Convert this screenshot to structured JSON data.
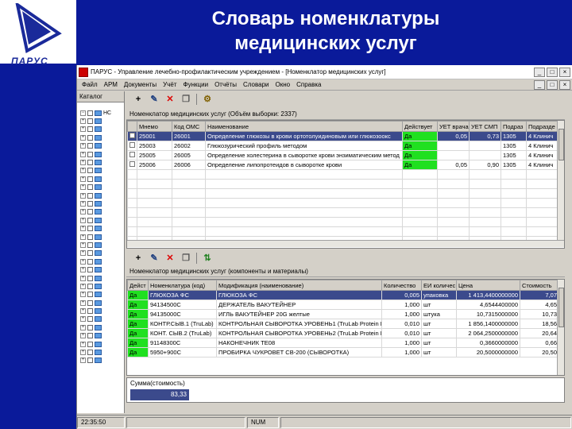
{
  "slide": {
    "title_line1": "Словарь номенклатуры",
    "title_line2": "медицинских услуг",
    "logo_text": "ПАРУС"
  },
  "window": {
    "title": "ПАРУС - Управление лечебно-профилактическим учреждением - [Номенклатор медицинских услуг]",
    "minimize": "_",
    "maximize": "□",
    "close": "×"
  },
  "menu": [
    "Файл",
    "АРМ",
    "Документы",
    "Учёт",
    "Функции",
    "Отчёты",
    "Словари",
    "Окно",
    "Справка"
  ],
  "menu_right": [
    "_",
    "□",
    "×"
  ],
  "left_panel": {
    "tab_label": "Каталог",
    "root_label": "НС",
    "rows": 31
  },
  "grid1": {
    "header_label": "Номенклатор медицинских услуг (Объём выборки: 2337)",
    "columns": [
      "",
      "Мнемо",
      "Код ОМС",
      "Наименование",
      "Действует",
      "УЕТ врача",
      "УЕТ СМП",
      "Подраз",
      "Подразде"
    ],
    "rows": [
      {
        "mnemo": "25001",
        "oms": "26001",
        "name": "Определение глюкозы в крови ортотолуидиновым или глюкозоокс",
        "active": "Да",
        "uet_doc": "0,05",
        "uet_smp": "0,73",
        "podr": "1305",
        "podr2": "4 Клинич",
        "selected": true
      },
      {
        "mnemo": "25003",
        "oms": "26002",
        "name": "Глюкозурический профиль методом",
        "active": "Да",
        "uet_doc": "",
        "uet_smp": "",
        "podr": "1305",
        "podr2": "4 Клинич",
        "selected": false
      },
      {
        "mnemo": "25005",
        "oms": "26005",
        "name": "Определение холестерина в сыворотке крови энзиматическим метод",
        "active": "Да",
        "uet_doc": "",
        "uet_smp": "",
        "podr": "1305",
        "podr2": "4 Клинич",
        "selected": false
      },
      {
        "mnemo": "25006",
        "oms": "26006",
        "name": "Определение липопротеидов в сыворотке крови",
        "active": "Да",
        "uet_doc": "0,05",
        "uet_smp": "0,90",
        "podr": "1305",
        "podr2": "4 Клинич",
        "selected": false
      }
    ]
  },
  "grid2": {
    "header_label": "Номенклатор медицинских услуг (компоненты и материалы)",
    "columns": [
      "Дейст",
      "Номенклатура (код)",
      "Модификация (наименование)",
      "Количество",
      "ЕИ количес",
      "Цена",
      "Стоимость"
    ],
    "rows": [
      {
        "active": "Да",
        "nom": "ГЛЮКОЗА ФС",
        "mod": "ГЛЮКОЗА ФС",
        "qty": "0,005",
        "unit": "упаковка",
        "price": "1 413,4400000000",
        "cost": "7,07",
        "selected": true
      },
      {
        "active": "Да",
        "nom": "94134500С",
        "mod": "ДЕРЖАТЕЛЬ ВАКУТЕЙНЕР",
        "qty": "1,000",
        "unit": "шт",
        "price": "4,6544400000",
        "cost": "4,65",
        "selected": false
      },
      {
        "active": "Да",
        "nom": "94135000С",
        "mod": "ИГЛЬ ВАКУТЕЙНЕР 20G желтые",
        "qty": "1,000",
        "unit": "штука",
        "price": "10,7315000000",
        "cost": "10,73",
        "selected": false
      },
      {
        "active": "Да",
        "nom": "КОНТР.СЫВ.1 (TruLab)",
        "mod": "КОНТРОЛЬНАЯ СЫВОРОТКА УРОВЕНЬ1 (TruLab Protein Leve",
        "qty": "0,010",
        "unit": "шт",
        "price": "1 856,1400000000",
        "cost": "18,56",
        "selected": false
      },
      {
        "active": "Да",
        "nom": "КОНТ. СЫВ.2 (TruLab)",
        "mod": "КОНТРОЛЬНАЯ СЫВОРОТКА УРОВЕНЬ2 (TruLab Protein Leve",
        "qty": "0,010",
        "unit": "шт",
        "price": "2 064,2500000000",
        "cost": "20,64",
        "selected": false
      },
      {
        "active": "Да",
        "nom": "91148300С",
        "mod": "НАКОНЕЧНИК ТЕ08",
        "qty": "1,000",
        "unit": "шт",
        "price": "0,3660000000",
        "cost": "0,66",
        "selected": false
      },
      {
        "active": "Да",
        "nom": "5950+900С",
        "mod": "ПРОБИРКА ЧУКРОВЕТ СВ-200 (СЫВОРОТКА)",
        "qty": "1,000",
        "unit": "шт",
        "price": "20,5000000000",
        "cost": "20,50",
        "selected": false
      }
    ]
  },
  "sum": {
    "label": "Сумма(стоимость)",
    "value": "83,33"
  },
  "status": {
    "time": "22:35:50",
    "mode": "NUM"
  },
  "colors": {
    "slide_bg": "#0a1a9a",
    "selection": "#3b4a8c",
    "active_green": "#20e020"
  }
}
